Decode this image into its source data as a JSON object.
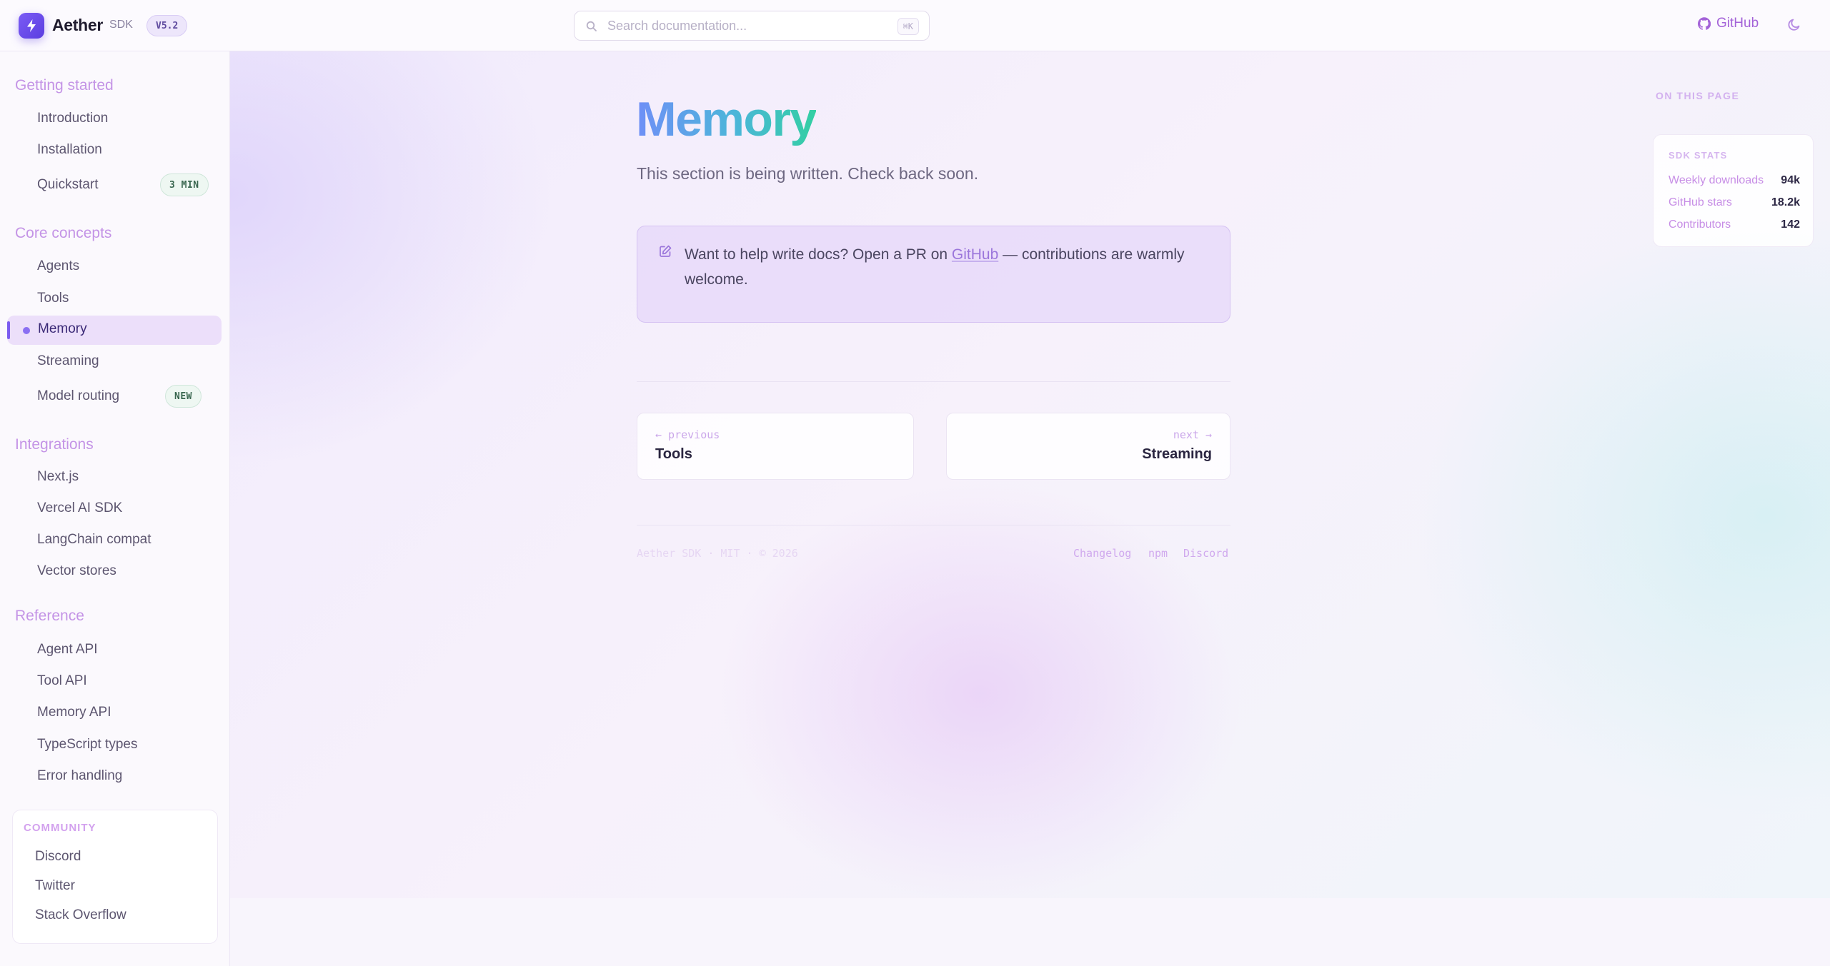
{
  "header": {
    "brand_name": "Aether",
    "brand_sub": "SDK",
    "version": "V5.2",
    "search_placeholder": "Search documentation...",
    "search_shortcut": "⌘K",
    "github_label": "GitHub",
    "icons": {
      "logo": "bolt-icon",
      "search": "search-icon",
      "github": "github-icon",
      "theme": "moon-icon"
    }
  },
  "sidebar": {
    "sections": [
      {
        "title": "Getting started",
        "items": [
          "Introduction",
          "Installation",
          "Quickstart"
        ]
      },
      {
        "title": "Core concepts",
        "items": [
          "Agents",
          "Tools",
          "Memory",
          "Streaming",
          "Model routing"
        ]
      },
      {
        "title": "Integrations",
        "items": [
          "Next.js",
          "Vercel AI SDK",
          "LangChain compat",
          "Vector stores"
        ]
      },
      {
        "title": "Reference",
        "items": [
          "Agent API",
          "Tool API",
          "Memory API",
          "TypeScript types",
          "Error handling"
        ]
      }
    ],
    "active_item": "Memory",
    "badges": {
      "quickstart": "3 MIN",
      "model_routing": "NEW"
    },
    "community": {
      "title": "COMMUNITY",
      "links": [
        "Discord",
        "Twitter",
        "Stack Overflow"
      ]
    }
  },
  "main": {
    "title": "Memory",
    "subtitle": "This section is being written. Check back soon.",
    "callout": {
      "text_before": "Want to help write docs? Open a PR on ",
      "link": "GitHub",
      "text_after": " — contributions are warmly welcome.",
      "icon": "edit-icon"
    },
    "pager": {
      "prev_label": "← previous",
      "prev_title": "Tools",
      "next_label": "next →",
      "next_title": "Streaming"
    },
    "footer": {
      "copyright": "Aether SDK · MIT · © 2026",
      "links": [
        "Changelog",
        "npm",
        "Discord"
      ]
    }
  },
  "right_rail": {
    "on_this_page": "ON THIS PAGE",
    "stats_title": "SDK STATS",
    "stats": [
      {
        "label": "Weekly downloads",
        "value": "94k"
      },
      {
        "label": "GitHub stars",
        "value": "18.2k"
      },
      {
        "label": "Contributors",
        "value": "142"
      }
    ]
  },
  "colors": {
    "accent": "#7c5cf0",
    "section_title": "#c494e6",
    "active_bg": "#ecdffa",
    "title_gradient": [
      "#6f8ff7",
      "#4cb6d9",
      "#33cfa3"
    ],
    "callout_bg": "#e6d7fa"
  }
}
